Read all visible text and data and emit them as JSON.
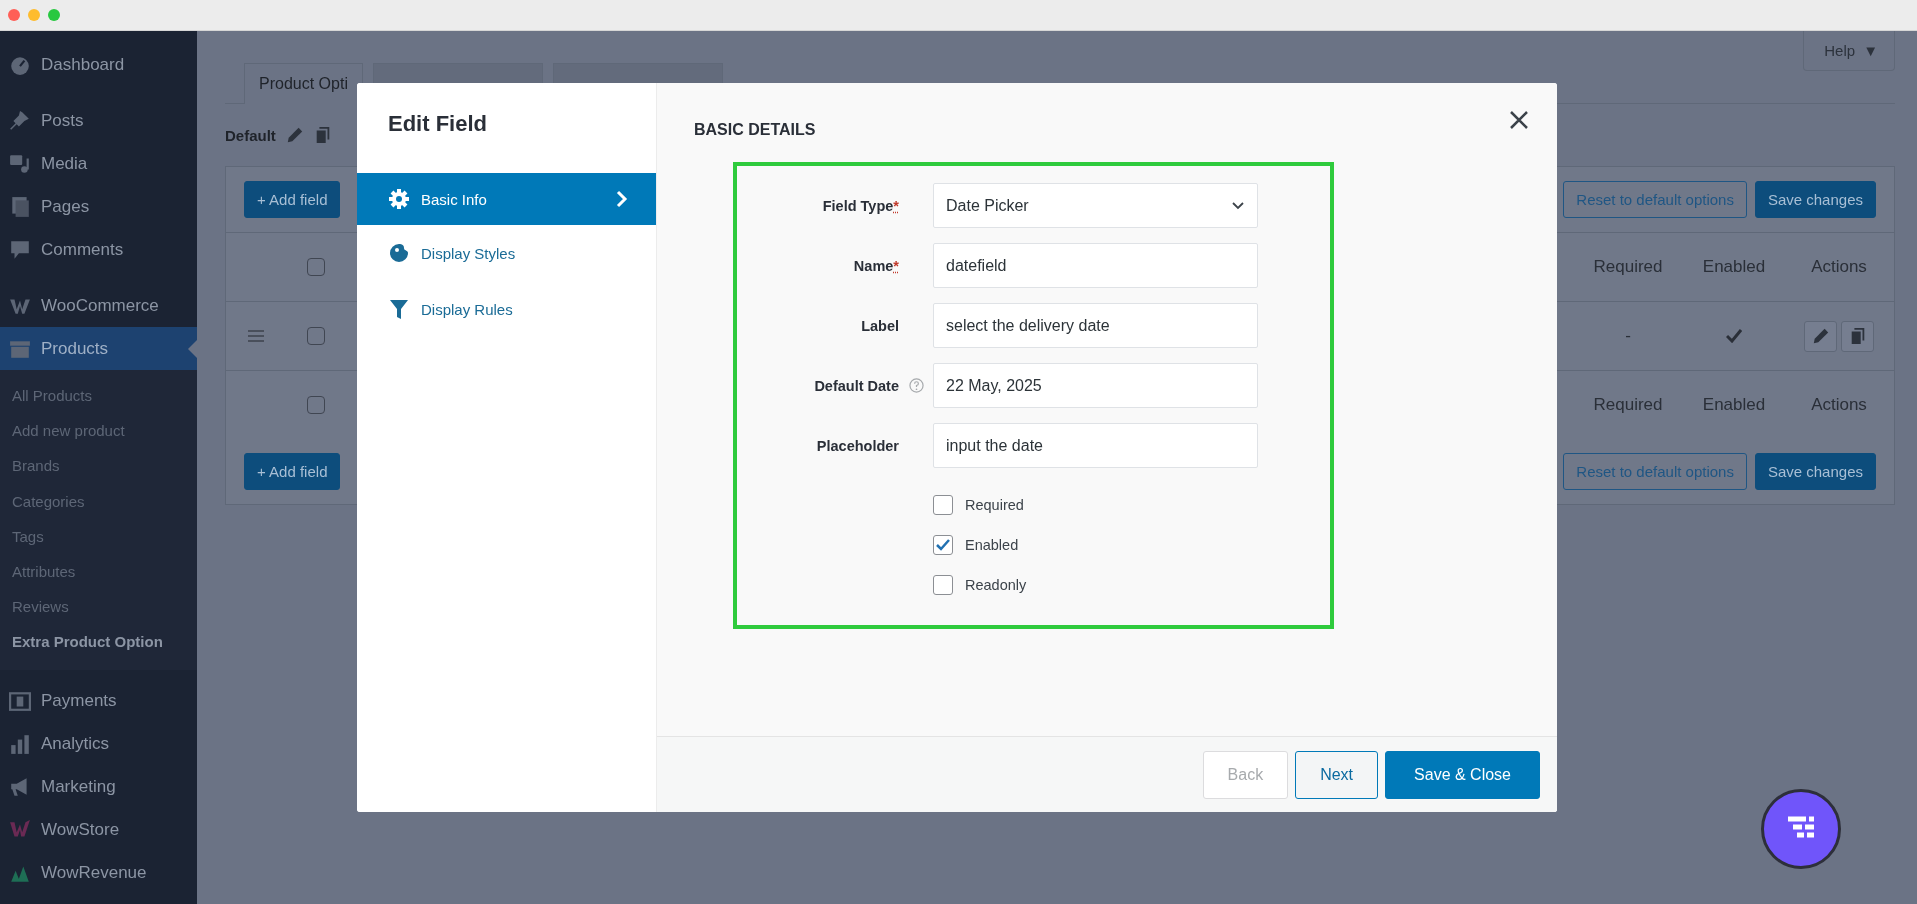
{
  "sidebar": {
    "items": [
      {
        "label": "Dashboard",
        "selected": false
      },
      {
        "label": "Posts",
        "selected": false
      },
      {
        "label": "Media",
        "selected": false
      },
      {
        "label": "Pages",
        "selected": false
      },
      {
        "label": "Comments",
        "selected": false
      },
      {
        "label": "WooCommerce",
        "selected": false
      },
      {
        "label": "Products",
        "selected": true
      }
    ],
    "submenu": [
      {
        "label": "All Products",
        "selected": false
      },
      {
        "label": "Add new product",
        "selected": false
      },
      {
        "label": "Brands",
        "selected": false
      },
      {
        "label": "Categories",
        "selected": false
      },
      {
        "label": "Tags",
        "selected": false
      },
      {
        "label": "Attributes",
        "selected": false
      },
      {
        "label": "Reviews",
        "selected": false
      },
      {
        "label": "Extra Product Option",
        "selected": true
      }
    ],
    "items_after": [
      {
        "label": "Payments",
        "selected": false
      },
      {
        "label": "Analytics",
        "selected": false
      },
      {
        "label": "Marketing",
        "selected": false
      },
      {
        "label": "WowStore",
        "selected": false
      },
      {
        "label": "WowRevenue",
        "selected": false
      }
    ]
  },
  "help_button": {
    "label": "Help",
    "caret": "▼"
  },
  "tabs": [
    {
      "label": "Product Opti",
      "selected": true
    }
  ],
  "option_set": {
    "name": "Default"
  },
  "table": {
    "toolbar": {
      "add_button": "+ Add field",
      "reset_button": "Reset to default options",
      "save_button": "Save changes"
    },
    "columns": [
      "Required",
      "Enabled",
      "Actions"
    ],
    "header_checked": false,
    "rows": [
      {
        "checked": false,
        "required": "-",
        "enabled": true
      }
    ],
    "footer_columns": [
      "Required",
      "Enabled",
      "Actions"
    ],
    "footer_checked": false,
    "bottom_toolbar": {
      "add_button": "+ Add field",
      "reset_button": "Reset to default options",
      "save_button": "Save changes"
    }
  },
  "modal": {
    "title": "Edit Field",
    "nav": [
      {
        "label": "Basic Info",
        "selected": true
      },
      {
        "label": "Display Styles",
        "selected": false
      },
      {
        "label": "Display Rules",
        "selected": false
      }
    ],
    "section_title": "BASIC DETAILS",
    "fields": [
      {
        "label": "Field Type",
        "required_mark": "*",
        "help": false,
        "kind": "select",
        "value": "Date Picker"
      },
      {
        "label": "Name",
        "required_mark": "*",
        "help": false,
        "kind": "text",
        "value": "datefield"
      },
      {
        "label": "Label",
        "help": false,
        "kind": "text",
        "value": "select the delivery date"
      },
      {
        "label": "Default Date",
        "help": true,
        "kind": "text",
        "value": "22 May, 2025"
      },
      {
        "label": "Placeholder",
        "help": false,
        "kind": "text",
        "value": "input the date"
      }
    ],
    "checkboxes": [
      {
        "label": "Required",
        "checked": false
      },
      {
        "label": "Enabled",
        "checked": true
      },
      {
        "label": "Readonly",
        "checked": false
      }
    ],
    "buttons": [
      {
        "label": "Back",
        "kind": "secondary",
        "disabled": true
      },
      {
        "label": "Next",
        "kind": "secondary",
        "disabled": false
      },
      {
        "label": "Save & Close",
        "kind": "primary",
        "disabled": false
      }
    ]
  }
}
